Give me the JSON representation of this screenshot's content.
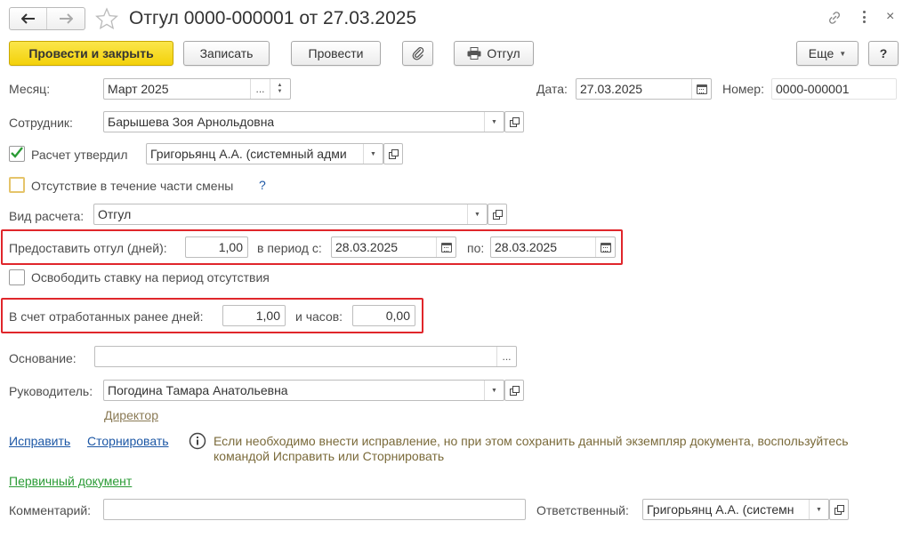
{
  "window": {
    "title": "Отгул 0000-000001 от 27.03.2025"
  },
  "toolbar": {
    "post_close": "Провести и закрыть",
    "save": "Записать",
    "post": "Провести",
    "print": "Отгул",
    "more": "Еще",
    "help": "?"
  },
  "month": {
    "label": "Месяц:",
    "value": "Март 2025",
    "dots": "..."
  },
  "date": {
    "label": "Дата:",
    "value": "27.03.2025"
  },
  "number": {
    "label": "Номер:",
    "value": "0000-000001"
  },
  "employee": {
    "label": "Сотрудник:",
    "value": "Барышева Зоя Арнольдовна"
  },
  "approved": {
    "label": "Расчет утвердил",
    "value": "Григорьянц А.А. (системный адми",
    "checked": true
  },
  "partial_absence": {
    "label": "Отсутствие в течение части смены",
    "help": "?",
    "checked": false
  },
  "calc_type": {
    "label": "Вид расчета:",
    "value": "Отгул"
  },
  "grant": {
    "label": "Предоставить отгул (дней):",
    "days": "1,00",
    "from_label": "в период с:",
    "from": "28.03.2025",
    "to_label": "по:",
    "to": "28.03.2025"
  },
  "free_rate": {
    "label": "Освободить ставку на период отсутствия",
    "checked": false
  },
  "worked": {
    "label": "В счет отработанных ранее дней:",
    "days": "1,00",
    "hours_label": "и часов:",
    "hours": "0,00"
  },
  "basis": {
    "label": "Основание:",
    "value": "",
    "dots": "..."
  },
  "manager": {
    "label": "Руководитель:",
    "value": "Погодина Тамара Анатольевна",
    "position": "Директор"
  },
  "correction": {
    "fix": "Исправить",
    "reverse": "Сторнировать",
    "info_line1": "Если необходимо внести исправление, но при этом сохранить данный экземпляр документа, воспользуйтесь",
    "info_line2": "командой Исправить или Сторнировать"
  },
  "primary_doc": "Первичный документ",
  "comment": {
    "label": "Комментарий:",
    "value": ""
  },
  "responsible": {
    "label": "Ответственный:",
    "value": "Григорьянц А.А. (системн"
  },
  "colors": {
    "accent_yellow": "#f3d10a",
    "link_blue": "#1c57a5",
    "link_green": "#2a9b35",
    "highlight_red": "#e0262b",
    "info_text": "#7a6a3a"
  }
}
